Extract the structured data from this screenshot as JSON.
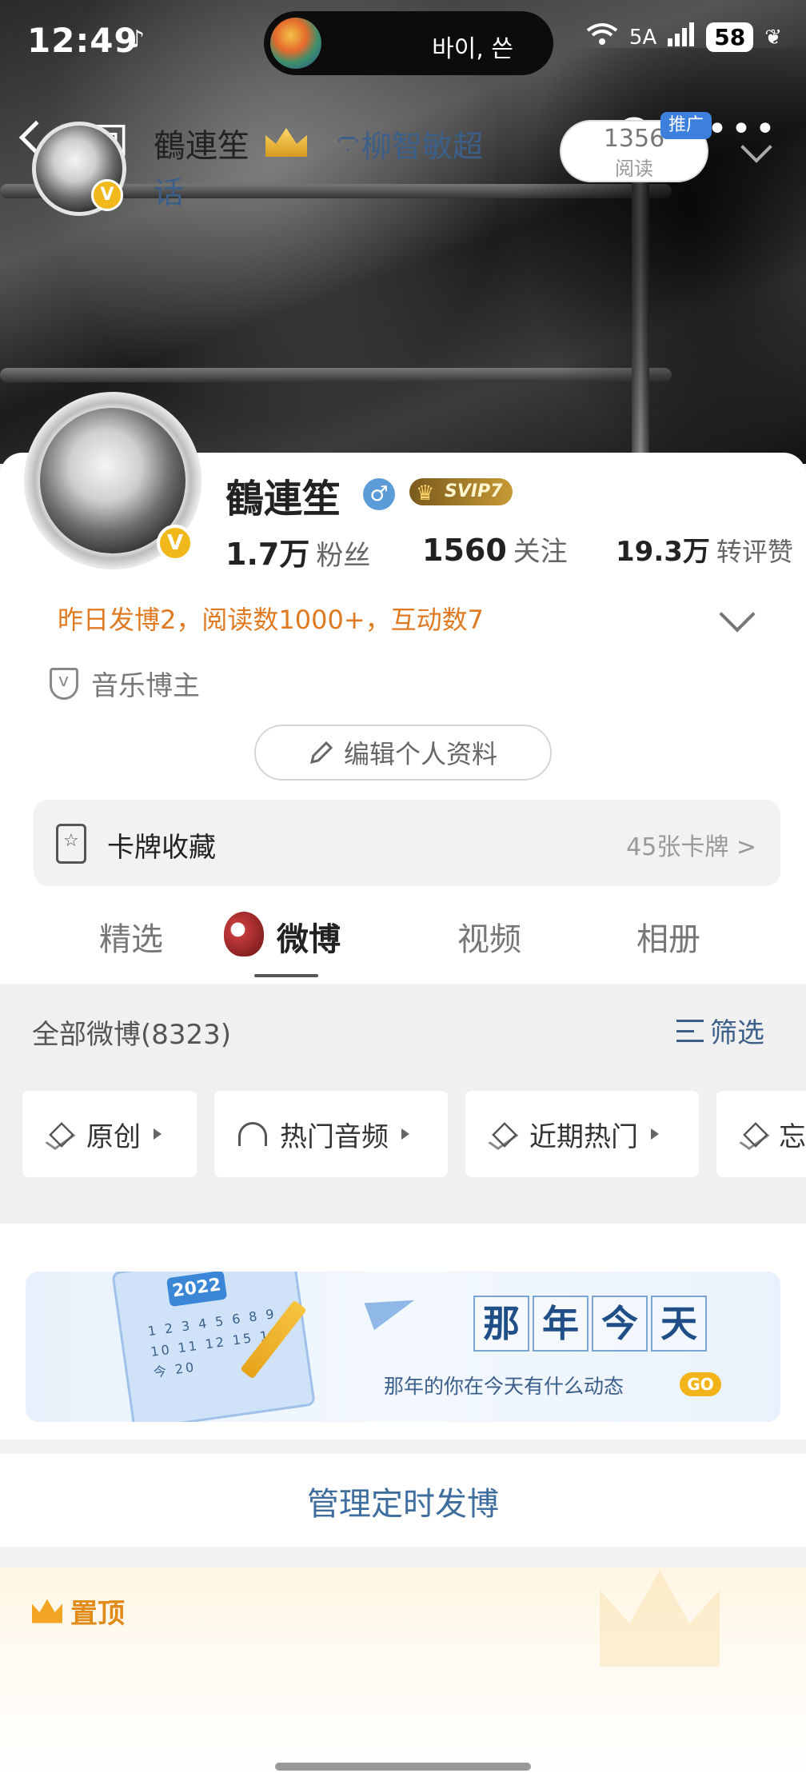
{
  "status_bar": {
    "time": "12:49",
    "media_text": "바이, 쓴",
    "network": "5A",
    "battery": "58"
  },
  "nav": {
    "back_label": "返回"
  },
  "profile": {
    "name": "鶴連笙",
    "vip_label": "SVIP7",
    "stats": [
      {
        "value": "1.7万",
        "label": "粉丝"
      },
      {
        "value": "1560",
        "label": "关注"
      },
      {
        "value": "19.3万",
        "label": "转评赞"
      }
    ],
    "summary": "昨日发博2，阅读数1000+，互动数7",
    "tag": "音乐博主",
    "edit_label": "编辑个人资料",
    "cards": {
      "title": "卡牌收藏",
      "count": "45张卡牌 >"
    }
  },
  "tabs": [
    {
      "label": "精选",
      "active": false
    },
    {
      "label": "微博",
      "active": true
    },
    {
      "label": "视频",
      "active": false
    },
    {
      "label": "相册",
      "active": false
    }
  ],
  "feed": {
    "all_label": "全部微博(8323)",
    "filter_label": "筛选",
    "chips": [
      {
        "label": "原创",
        "icon": "layers-icon"
      },
      {
        "label": "热门音频",
        "icon": "headphones-icon"
      },
      {
        "label": "近期热门",
        "icon": "layers-icon"
      },
      {
        "label": "忘",
        "icon": "layers-icon"
      }
    ]
  },
  "banner": {
    "calendar_year": "2022",
    "calendar_numbers": "1 2 3 4 5 6 8 9 10 11 12 15 16 今 20",
    "title_chars": [
      "那",
      "年",
      "今",
      "天"
    ],
    "subtitle": "那年的你在今天有什么动态",
    "go_label": "GO"
  },
  "schedule": {
    "label": "管理定时发博"
  },
  "pinned": {
    "label": "置顶",
    "author": "鶴連笙",
    "super_topic_line1": "柳智敏超",
    "super_topic_line2": "话",
    "read_count": "1356",
    "read_label": "阅读",
    "promo_label": "推广"
  },
  "colors": {
    "accent_orange": "#e07a22",
    "link_blue": "#3c5f8a",
    "vip_gold": "#f0b81a"
  }
}
